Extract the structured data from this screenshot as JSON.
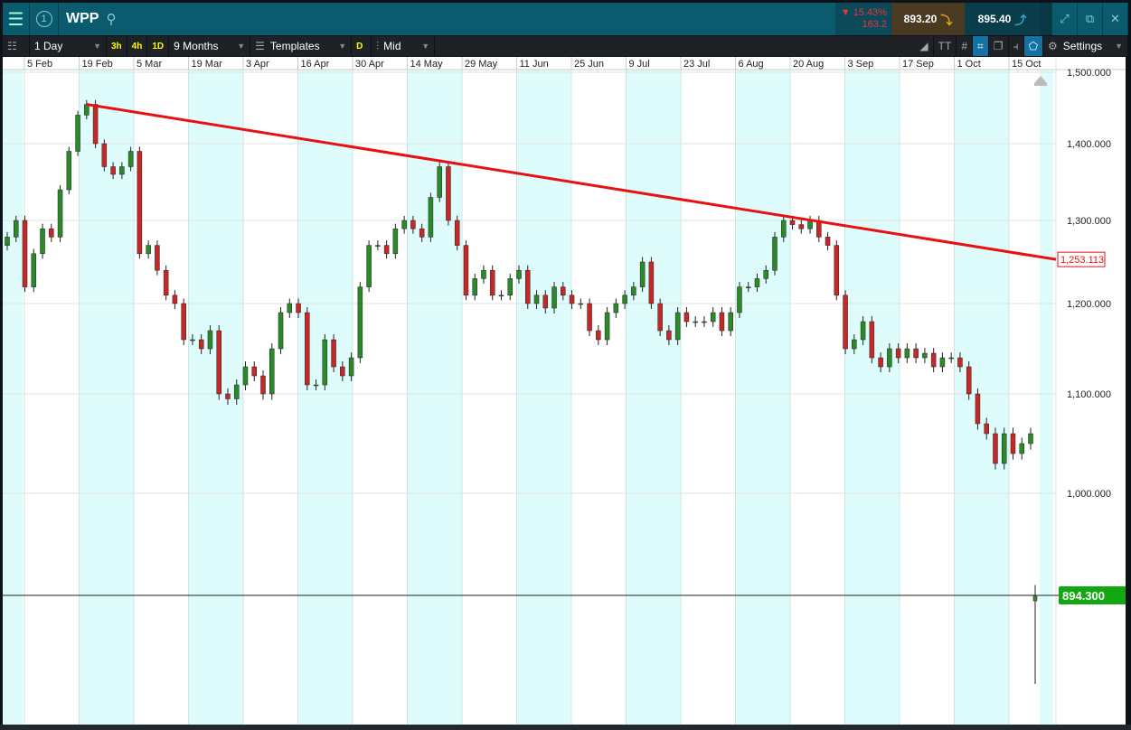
{
  "header": {
    "symbol": "WPP",
    "change_pct": "15.43%",
    "change_abs": "163.2",
    "sell": "893.20",
    "buy": "895.40"
  },
  "toolbar": {
    "interval": "1 Day",
    "quick": [
      "3h",
      "4h",
      "1D"
    ],
    "range": "9 Months",
    "templates": "Templates",
    "d_label": "D",
    "price_type": "Mid",
    "settings": "Settings"
  },
  "colors": {
    "up": "#2a8a2a",
    "down": "#c62828",
    "trend": "#e81010",
    "last": "#12a812",
    "stripe": "#dffcfc"
  },
  "chart_data": {
    "type": "candlestick",
    "x_labels": [
      "5 Feb",
      "19 Feb",
      "5 Mar",
      "19 Mar",
      "3 Apr",
      "16 Apr",
      "30 Apr",
      "14 May",
      "29 May",
      "11 Jun",
      "25 Jun",
      "9 Jul",
      "23 Jul",
      "6 Aug",
      "20 Aug",
      "3 Sep",
      "17 Sep",
      "1 Oct",
      "15 Oct"
    ],
    "y_ticks": [
      "1,500.000",
      "1,400.000",
      "1,300.000",
      "1,200.000",
      "1,100.000",
      "1,000.000"
    ],
    "y_tick_values": [
      1500,
      1400,
      1300,
      1200,
      1100,
      1000
    ],
    "closes": [
      1280,
      1300,
      1220,
      1260,
      1290,
      1280,
      1340,
      1390,
      1440,
      1455,
      1400,
      1370,
      1360,
      1370,
      1390,
      1260,
      1270,
      1240,
      1210,
      1200,
      1160,
      1160,
      1150,
      1170,
      1100,
      1095,
      1110,
      1130,
      1120,
      1100,
      1150,
      1190,
      1200,
      1190,
      1110,
      1110,
      1160,
      1130,
      1120,
      1140,
      1220,
      1270,
      1270,
      1260,
      1290,
      1300,
      1290,
      1280,
      1330,
      1370,
      1300,
      1270,
      1210,
      1230,
      1240,
      1210,
      1210,
      1230,
      1240,
      1200,
      1210,
      1195,
      1220,
      1210,
      1200,
      1200,
      1170,
      1160,
      1190,
      1200,
      1210,
      1220,
      1250,
      1200,
      1170,
      1160,
      1190,
      1180,
      1180,
      1180,
      1190,
      1170,
      1190,
      1220,
      1220,
      1230,
      1240,
      1280,
      1300,
      1295,
      1290,
      1300,
      1280,
      1270,
      1210,
      1150,
      1160,
      1180,
      1140,
      1130,
      1150,
      1140,
      1150,
      1140,
      1145,
      1130,
      1140,
      1140,
      1130,
      1100,
      1070,
      1060,
      1030,
      1060,
      1040,
      1050,
      1060
    ],
    "last_candle": {
      "open": 890,
      "high": 905,
      "low": 825,
      "close": 894.3
    },
    "trendline": {
      "start_index": 9,
      "start_value": 1455,
      "end_value": 1253.113,
      "end_label": "1,253.113"
    },
    "last_price_label": "894.300"
  }
}
